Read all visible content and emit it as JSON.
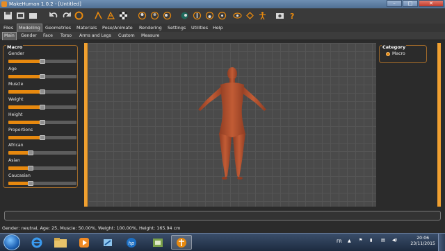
{
  "window": {
    "title": "MakeHuman 1.0.2 - [Untitled]",
    "controls": [
      "minimize",
      "maximize",
      "close"
    ]
  },
  "toolbar": {
    "icons": [
      "save-icon",
      "open-icon",
      "export-icon",
      "undo-icon",
      "redo-icon",
      "reset-icon",
      "smooth-icon",
      "wireframe-icon",
      "background-icon",
      "checker-icon",
      "front-view-icon",
      "back-view-icon",
      "left-view-icon",
      "right-view-icon",
      "top-view-icon",
      "bottom-view-icon",
      "reset-camera-icon",
      "pose-icon",
      "screenshot-icon",
      "help-icon"
    ]
  },
  "menu": [
    "Files",
    "Modelling",
    "Geometries",
    "Materials",
    "Pose/Animate",
    "Rendering",
    "Settings",
    "Utilities",
    "Help"
  ],
  "submenu": [
    "Main",
    "Gender",
    "Face",
    "Torso",
    "Arms and Legs",
    "Custom",
    "Measure"
  ],
  "macro": {
    "title": "Macro",
    "sliders": [
      {
        "label": "Gender",
        "value": 0.5
      },
      {
        "label": "Age",
        "value": 0.5
      },
      {
        "label": "Muscle",
        "value": 0.5
      },
      {
        "label": "Weight",
        "value": 0.5
      },
      {
        "label": "Height",
        "value": 0.5
      },
      {
        "label": "Proportions",
        "value": 0.5
      },
      {
        "label": "African",
        "value": 0.33
      },
      {
        "label": "Asian",
        "value": 0.33
      },
      {
        "label": "Caucasian",
        "value": 0.33
      }
    ]
  },
  "category": {
    "title": "Category",
    "selected": "Macro"
  },
  "status": "Gender: neutral, Age: 25, Muscle: 50.00%, Weight: 100.00%, Height: 165.94 cm",
  "taskbar": {
    "apps": [
      "ie-icon",
      "explorer-icon",
      "media-player-icon",
      "network-icon",
      "hp-icon",
      "app-icon",
      "makehuman-icon"
    ],
    "lang": "FR",
    "time": "20:06",
    "date": "23/11/2015"
  },
  "colors": {
    "accent": "#e7890f",
    "viewport": "#4a4a4a",
    "skin": "#b5532f"
  }
}
